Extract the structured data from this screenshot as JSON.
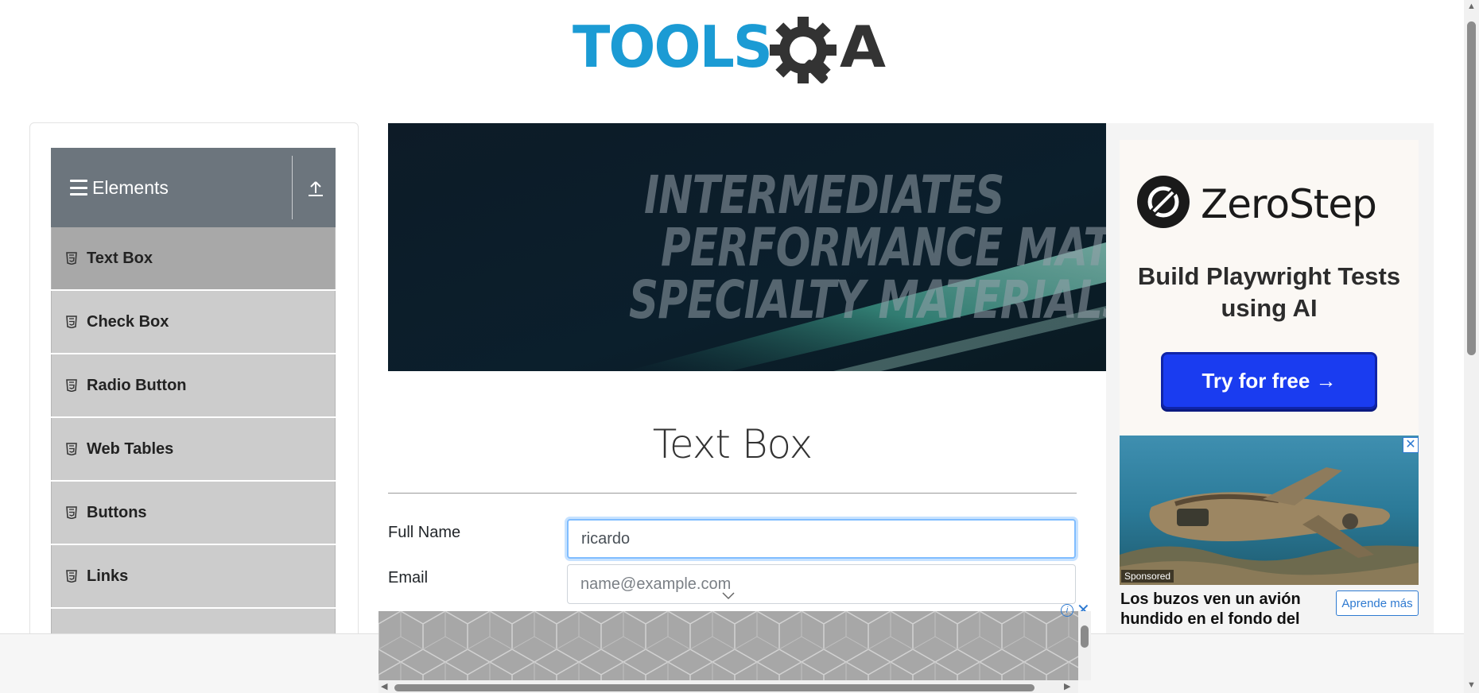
{
  "logo": {
    "text_left": "TOOLS",
    "text_right": "A"
  },
  "sidebar": {
    "group_title": "Elements",
    "items": [
      {
        "label": "Text Box",
        "active": true
      },
      {
        "label": "Check Box"
      },
      {
        "label": "Radio Button"
      },
      {
        "label": "Web Tables"
      },
      {
        "label": "Buttons"
      },
      {
        "label": "Links"
      }
    ]
  },
  "banner": {
    "line1": "INTERMEDIATES",
    "line2": "PERFORMANCE MATERIALS",
    "line3": "SPECIALTY MATERIALS"
  },
  "main": {
    "title": "Text Box",
    "full_name": {
      "label": "Full Name",
      "value": "ricardo"
    },
    "email": {
      "label": "Email",
      "placeholder": "name@example.com"
    }
  },
  "right_ad": {
    "brand": "ZeroStep",
    "tagline": "Build Playwright Tests using AI",
    "cta": "Try for free →",
    "sponsored": "Sponsored",
    "headline": "Los buzos ven un avión hundido en el fondo del",
    "learn_more": "Aprende más",
    "close": "✕"
  },
  "bottom_ad": {
    "adchoices": "i",
    "close": "✕"
  },
  "colors": {
    "logo_blue": "#1b9bd4",
    "logo_dark": "#333333",
    "sidebar_header": "#6c757d",
    "menu_active": "#a8a8a8",
    "menu_item": "#cccccc",
    "cta_blue": "#1a3cf0",
    "focus_border": "#80bdff"
  }
}
